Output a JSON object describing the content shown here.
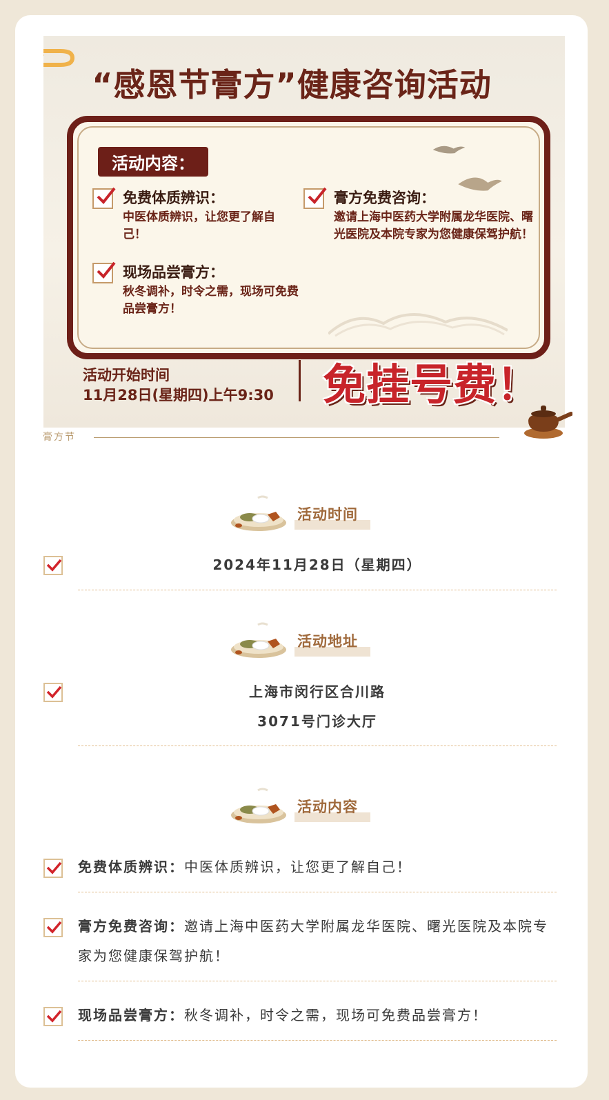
{
  "poster": {
    "title": "“感恩节膏方”健康咨询活动",
    "box_label": "活动内容：",
    "items": [
      {
        "title": "免费体质辨识：",
        "desc": "中医体质辨识，让您更了解自己！"
      },
      {
        "title": "膏方免费咨询：",
        "desc": "邀请上海中医药大学附属龙华医院、曙光医院及本院专家为您健康保驾护航！"
      },
      {
        "title": "现场品尝膏方：",
        "desc": "秋冬调补，时令之需，现场可免费品尝膏方！"
      }
    ],
    "start_label": "活动开始时间",
    "start_time": "11月28日(星期四)上午9:30",
    "free_text": "免挂号费！"
  },
  "section_tag": "膏方节",
  "sections": {
    "time": {
      "title": "活动时间",
      "value": "2024年11月28日（星期四）"
    },
    "address": {
      "title": "活动地址",
      "line1": "上海市闵行区合川路",
      "line2": "3071号门诊大厅"
    },
    "content": {
      "title": "活动内容",
      "items": [
        {
          "label": "免费体质辨识：",
          "text": "中医体质辨识，让您更了解自己！"
        },
        {
          "label": "膏方免费咨询：",
          "text": "邀请上海中医药大学附属龙华医院、曙光医院及本院专家为您健康保驾护航！"
        },
        {
          "label": "现场品尝膏方：",
          "text": "秋冬调补，时令之需，现场可免费品尝膏方！"
        }
      ]
    }
  },
  "icons": [
    "checkbox-check-icon",
    "herb-plate-icon",
    "clay-pot-icon",
    "crane-icon",
    "swirl-decoration-icon"
  ],
  "colors": {
    "accent_red": "#c8242a",
    "brown": "#6d1f18",
    "gold": "#b89a6e",
    "section_title": "#a06a3c"
  }
}
